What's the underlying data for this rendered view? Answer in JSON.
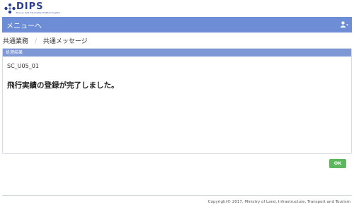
{
  "header": {
    "logo_text": "DIPS",
    "logo_subtitle": "Drone / UAS Information Platform System"
  },
  "nav": {
    "menu_label": "メニューへ",
    "user_icon": "user-icon"
  },
  "breadcrumb": {
    "items": [
      "共通業務",
      "共通メッセージ"
    ],
    "separator": "/"
  },
  "panel": {
    "heading": "処理結果",
    "screen_id": "SC_U05_01",
    "message": "飛行実績の登録が完了しました。"
  },
  "actions": {
    "ok_label": "OK"
  },
  "footer": {
    "copyright": "Copyright© 2017, Ministry of Land, Infrastructure, Transport and Tourism"
  },
  "colors": {
    "nav_bar": "#6d8ed6",
    "panel_heading": "#7e98d6",
    "ok_button": "#5cb85c",
    "logo": "#2a3f8f"
  }
}
